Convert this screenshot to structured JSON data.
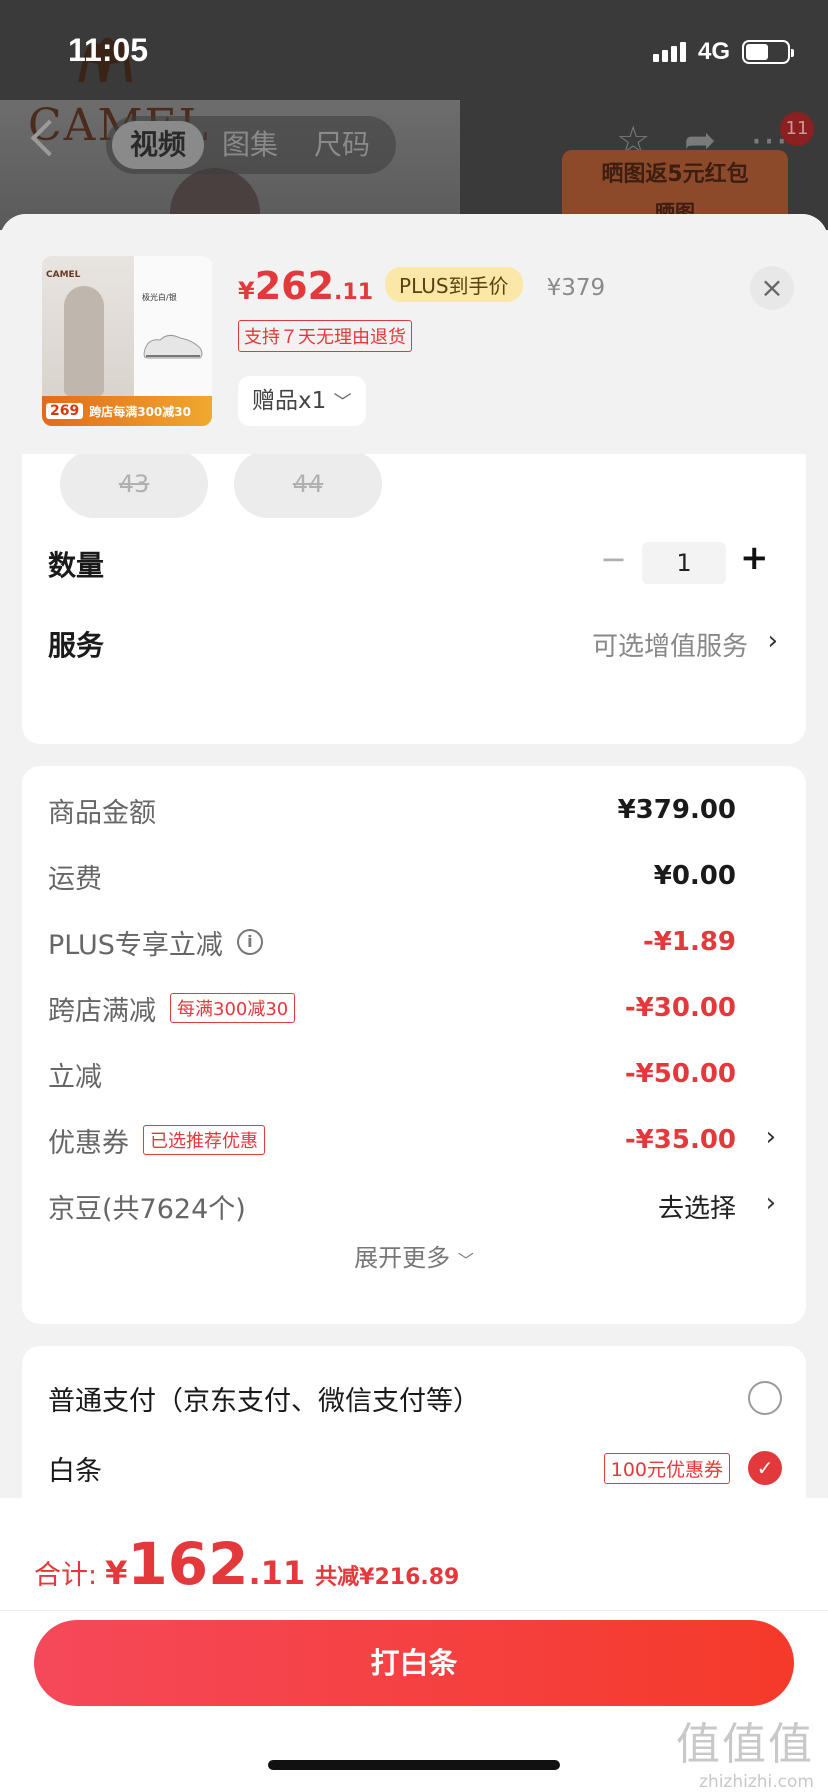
{
  "status_bar": {
    "time": "11:05",
    "network": "4G",
    "battery_level": 0.55
  },
  "header": {
    "tabs": [
      "视频",
      "图集",
      "尺码"
    ],
    "active_tab": 0,
    "badge_count": "11",
    "promo_text": "晒图返5元红包",
    "promo_sub": "晒图"
  },
  "product": {
    "thumb_brand": "CAMEL",
    "thumb_title": "极光白/银",
    "thumb_price": "269",
    "thumb_promo": "跨店每满300减30",
    "currency": "¥",
    "price_int": "262",
    "price_dec": ".11",
    "plus_tag": "PLUS到手价",
    "original_price": "¥379",
    "return_tag": "支持７天无理由退货",
    "gift": "赠品x1"
  },
  "sizes": [
    "43",
    "44"
  ],
  "quantity": {
    "label": "数量",
    "value": "1",
    "minus": "−",
    "plus": "+"
  },
  "service": {
    "label": "服务",
    "value": "可选增值服务"
  },
  "price_breakdown": {
    "rows": [
      {
        "label": "商品金额",
        "value": "¥379.00"
      },
      {
        "label": "运费",
        "value": "¥0.00"
      },
      {
        "label": "PLUS专享立减",
        "value": "-¥1.89"
      },
      {
        "label": "跨店满减",
        "tag": "每满300减30",
        "value": "-¥30.00"
      },
      {
        "label": "立减",
        "value": "-¥50.00"
      },
      {
        "label": "优惠券",
        "tag": "已选推荐优惠",
        "value": "-¥35.00"
      },
      {
        "label": "京豆(共7624个)",
        "value": "去选择"
      }
    ],
    "expand": "展开更多"
  },
  "payment": {
    "options": [
      {
        "label": "普通支付（京东支付、微信支付等）",
        "selected": false
      },
      {
        "label": "白条",
        "tag": "100元优惠券",
        "selected": true
      }
    ]
  },
  "total": {
    "label": "合计:",
    "currency": "¥",
    "int": "162",
    "dec": ".11",
    "saved": "共减¥216.89"
  },
  "pay_button": "打白条",
  "watermark": {
    "glyph": "值值值",
    "url": "zhizhizhi.com"
  },
  "colors": {
    "accent": "#e4393c",
    "plus_tag_bg": "#fbe7a8",
    "button_gradient": [
      "#f5485a",
      "#f53a2a"
    ]
  }
}
